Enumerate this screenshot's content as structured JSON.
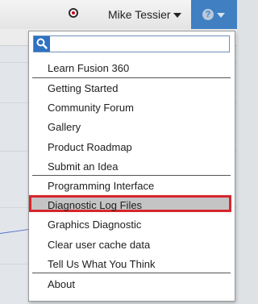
{
  "topbar": {
    "user_name": "Mike Tessier",
    "help_symbol": "?"
  },
  "help_menu": {
    "search": {
      "value": "",
      "placeholder": ""
    },
    "sections": [
      [
        "Learn Fusion 360"
      ],
      [
        "Getting Started",
        "Community Forum",
        "Gallery",
        "Product Roadmap",
        "Submit an Idea"
      ],
      [
        "Programming Interface",
        "Diagnostic Log Files",
        "Graphics Diagnostic",
        "Clear user cache data",
        "Tell Us What You Think"
      ],
      [
        "About"
      ]
    ],
    "highlighted_item": "Diagnostic Log Files",
    "highlight_color": "#d6262c"
  },
  "colors": {
    "help_button": "#3f7fc2",
    "record_dot": "#d0021b"
  }
}
